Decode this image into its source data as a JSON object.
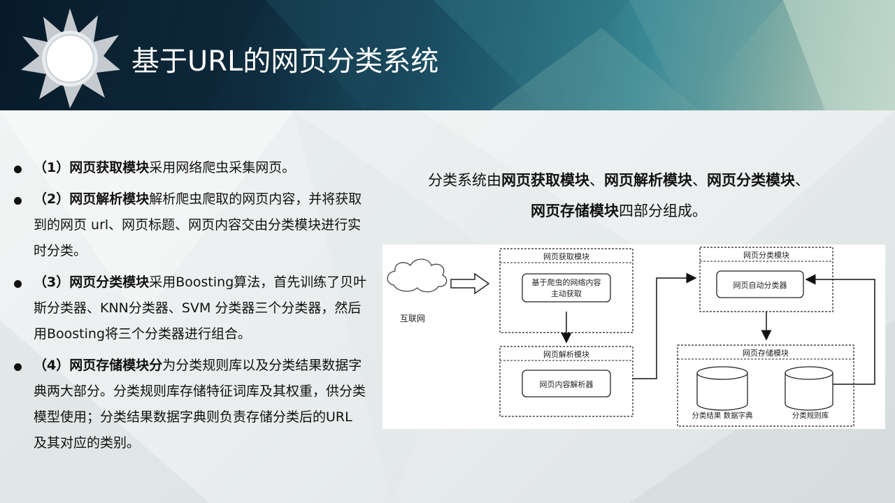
{
  "title": "基于URL的网页分类系统",
  "bullets": [
    {
      "num": "（1）",
      "bold": "网页获取模块",
      "text": "采用网络爬虫采集网页。"
    },
    {
      "num": "（2）",
      "bold": "网页解析模块",
      "text": "解析爬虫爬取的网页内容，并将获取到的网页 url、网页标题、网页内容交由分类模块进行实时分类。"
    },
    {
      "num": "（3）",
      "bold": "网页分类模块",
      "text": "采用Boosting算法，首先训练了贝叶斯分类器、KNN分类器、SVM 分类器三个分类器，然后用Boosting将三个分类器进行组合。"
    },
    {
      "num": "（4）",
      "bold": "网页存储模块分",
      "text": "为分类规则库以及分类结果数据字典两大部分。分类规则库存储特征词库及其权重，供分类模型使用；分类结果数据字典则负责存储分类后的URL 及其对应的类别。"
    }
  ],
  "summary": {
    "prefix": "分类系统由",
    "m1": "网页获取模块",
    "sep1": "、",
    "m2": "网页解析模块",
    "sep2": "、",
    "m3": "网页分类模块",
    "sep3": "、",
    "m4": "网页存储模块",
    "suffix": "四部分组成。"
  },
  "diagram": {
    "internet": "互联网",
    "fetch_module": "网页获取模块",
    "fetch_inner_line1": "基于爬虫的网络内容",
    "fetch_inner_line2": "主动获取",
    "parse_module": "网页解析模块",
    "parse_inner": "网页内容解析器",
    "classify_module": "网页分类模块",
    "classify_inner": "网页自动分类器",
    "storage_module": "网页存储模块",
    "db1": "分类结果 数据字典",
    "db2": "分类规则库"
  }
}
